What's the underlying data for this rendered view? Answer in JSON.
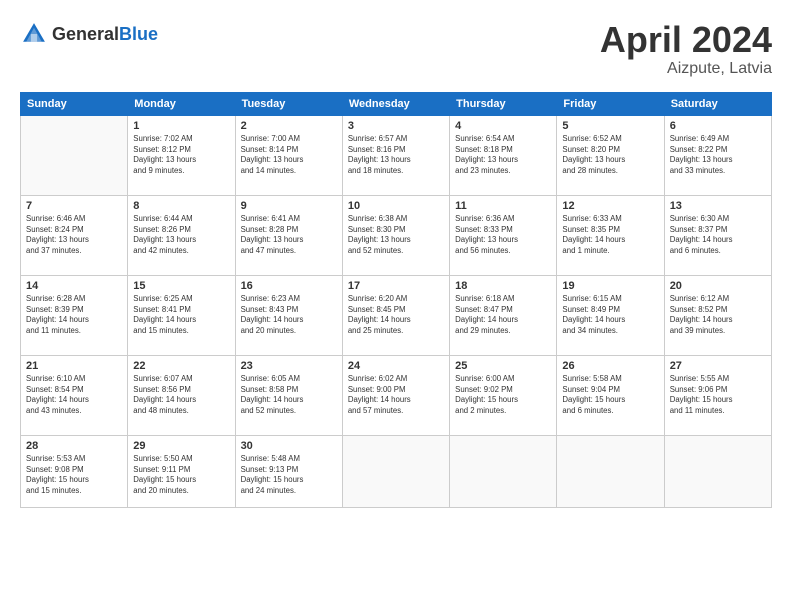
{
  "header": {
    "logo_general": "General",
    "logo_blue": "Blue",
    "month_year": "April 2024",
    "location": "Aizpute, Latvia"
  },
  "days_of_week": [
    "Sunday",
    "Monday",
    "Tuesday",
    "Wednesday",
    "Thursday",
    "Friday",
    "Saturday"
  ],
  "weeks": [
    [
      {
        "day": "",
        "info": ""
      },
      {
        "day": "1",
        "info": "Sunrise: 7:02 AM\nSunset: 8:12 PM\nDaylight: 13 hours\nand 9 minutes."
      },
      {
        "day": "2",
        "info": "Sunrise: 7:00 AM\nSunset: 8:14 PM\nDaylight: 13 hours\nand 14 minutes."
      },
      {
        "day": "3",
        "info": "Sunrise: 6:57 AM\nSunset: 8:16 PM\nDaylight: 13 hours\nand 18 minutes."
      },
      {
        "day": "4",
        "info": "Sunrise: 6:54 AM\nSunset: 8:18 PM\nDaylight: 13 hours\nand 23 minutes."
      },
      {
        "day": "5",
        "info": "Sunrise: 6:52 AM\nSunset: 8:20 PM\nDaylight: 13 hours\nand 28 minutes."
      },
      {
        "day": "6",
        "info": "Sunrise: 6:49 AM\nSunset: 8:22 PM\nDaylight: 13 hours\nand 33 minutes."
      }
    ],
    [
      {
        "day": "7",
        "info": "Sunrise: 6:46 AM\nSunset: 8:24 PM\nDaylight: 13 hours\nand 37 minutes."
      },
      {
        "day": "8",
        "info": "Sunrise: 6:44 AM\nSunset: 8:26 PM\nDaylight: 13 hours\nand 42 minutes."
      },
      {
        "day": "9",
        "info": "Sunrise: 6:41 AM\nSunset: 8:28 PM\nDaylight: 13 hours\nand 47 minutes."
      },
      {
        "day": "10",
        "info": "Sunrise: 6:38 AM\nSunset: 8:30 PM\nDaylight: 13 hours\nand 52 minutes."
      },
      {
        "day": "11",
        "info": "Sunrise: 6:36 AM\nSunset: 8:33 PM\nDaylight: 13 hours\nand 56 minutes."
      },
      {
        "day": "12",
        "info": "Sunrise: 6:33 AM\nSunset: 8:35 PM\nDaylight: 14 hours\nand 1 minute."
      },
      {
        "day": "13",
        "info": "Sunrise: 6:30 AM\nSunset: 8:37 PM\nDaylight: 14 hours\nand 6 minutes."
      }
    ],
    [
      {
        "day": "14",
        "info": "Sunrise: 6:28 AM\nSunset: 8:39 PM\nDaylight: 14 hours\nand 11 minutes."
      },
      {
        "day": "15",
        "info": "Sunrise: 6:25 AM\nSunset: 8:41 PM\nDaylight: 14 hours\nand 15 minutes."
      },
      {
        "day": "16",
        "info": "Sunrise: 6:23 AM\nSunset: 8:43 PM\nDaylight: 14 hours\nand 20 minutes."
      },
      {
        "day": "17",
        "info": "Sunrise: 6:20 AM\nSunset: 8:45 PM\nDaylight: 14 hours\nand 25 minutes."
      },
      {
        "day": "18",
        "info": "Sunrise: 6:18 AM\nSunset: 8:47 PM\nDaylight: 14 hours\nand 29 minutes."
      },
      {
        "day": "19",
        "info": "Sunrise: 6:15 AM\nSunset: 8:49 PM\nDaylight: 14 hours\nand 34 minutes."
      },
      {
        "day": "20",
        "info": "Sunrise: 6:12 AM\nSunset: 8:52 PM\nDaylight: 14 hours\nand 39 minutes."
      }
    ],
    [
      {
        "day": "21",
        "info": "Sunrise: 6:10 AM\nSunset: 8:54 PM\nDaylight: 14 hours\nand 43 minutes."
      },
      {
        "day": "22",
        "info": "Sunrise: 6:07 AM\nSunset: 8:56 PM\nDaylight: 14 hours\nand 48 minutes."
      },
      {
        "day": "23",
        "info": "Sunrise: 6:05 AM\nSunset: 8:58 PM\nDaylight: 14 hours\nand 52 minutes."
      },
      {
        "day": "24",
        "info": "Sunrise: 6:02 AM\nSunset: 9:00 PM\nDaylight: 14 hours\nand 57 minutes."
      },
      {
        "day": "25",
        "info": "Sunrise: 6:00 AM\nSunset: 9:02 PM\nDaylight: 15 hours\nand 2 minutes."
      },
      {
        "day": "26",
        "info": "Sunrise: 5:58 AM\nSunset: 9:04 PM\nDaylight: 15 hours\nand 6 minutes."
      },
      {
        "day": "27",
        "info": "Sunrise: 5:55 AM\nSunset: 9:06 PM\nDaylight: 15 hours\nand 11 minutes."
      }
    ],
    [
      {
        "day": "28",
        "info": "Sunrise: 5:53 AM\nSunset: 9:08 PM\nDaylight: 15 hours\nand 15 minutes."
      },
      {
        "day": "29",
        "info": "Sunrise: 5:50 AM\nSunset: 9:11 PM\nDaylight: 15 hours\nand 20 minutes."
      },
      {
        "day": "30",
        "info": "Sunrise: 5:48 AM\nSunset: 9:13 PM\nDaylight: 15 hours\nand 24 minutes."
      },
      {
        "day": "",
        "info": ""
      },
      {
        "day": "",
        "info": ""
      },
      {
        "day": "",
        "info": ""
      },
      {
        "day": "",
        "info": ""
      }
    ]
  ]
}
